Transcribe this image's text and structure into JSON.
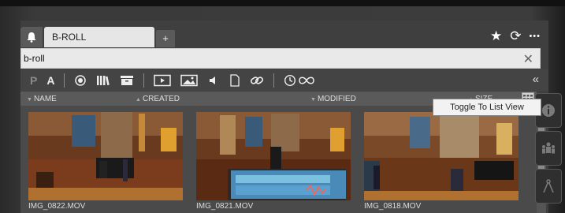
{
  "tab": {
    "label": "B-ROLL",
    "add_label": "+"
  },
  "top_actions": {
    "star": "★",
    "refresh": "⟳",
    "more": "•••"
  },
  "search": {
    "value": "b-roll",
    "clear_icon": "✕"
  },
  "toolbar": {
    "p_label": "P",
    "a_label": "A",
    "collapse_icon": "«"
  },
  "columns": {
    "name": "NAME",
    "created": "CREATED",
    "modified": "MODIFIED",
    "size": "SIZE"
  },
  "tooltip": {
    "text": "Toggle To List View"
  },
  "items": [
    {
      "filename": "IMG_0822.MOV"
    },
    {
      "filename": "IMG_0821.MOV"
    },
    {
      "filename": "IMG_0818.MOV"
    }
  ],
  "colors": {
    "tab_bg": "#e6e6e6",
    "panel": "#3f3f3f",
    "toolbar": "#444444"
  }
}
